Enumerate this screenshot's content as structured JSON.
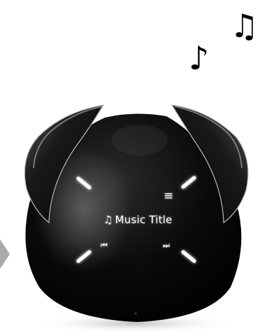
{
  "scene": {
    "music_notes": [
      {
        "name": "double-eighth-note-icon",
        "glyph": "♫"
      },
      {
        "name": "eighth-note-icon",
        "glyph": "♪"
      }
    ],
    "colors": {
      "background": "#ffffff",
      "speaker_body": "#050505",
      "glow": "#ffffff",
      "pointer": "#a9a9a9"
    }
  },
  "display": {
    "music_icon": "♫",
    "title": "Music Title",
    "menu_icon": "≡",
    "prev_icon": "⏮",
    "next_icon": "⏭"
  }
}
